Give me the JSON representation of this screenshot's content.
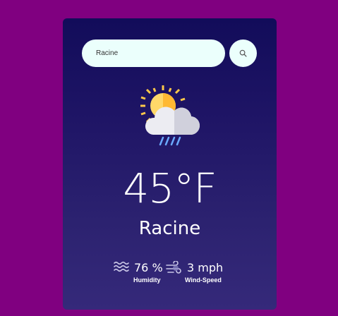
{
  "search": {
    "value": "Racine",
    "placeholder": ""
  },
  "weather": {
    "temperature": "45°F",
    "city": "Racine",
    "condition_icon": "sun-cloud-rain-icon"
  },
  "details": {
    "humidity": {
      "value": "76 %",
      "label": "Humidity",
      "icon": "humidity-icon"
    },
    "wind": {
      "value": "3 mph",
      "label": "Wind-Speed",
      "icon": "wind-icon"
    }
  },
  "colors": {
    "background": "#800080",
    "card_top": "#120c5a",
    "card_bottom": "#35297a",
    "input_bg": "#ebfffc",
    "sun": "#ffc94a",
    "cloud": "#e8e8ee",
    "rain": "#6aa9ff"
  }
}
